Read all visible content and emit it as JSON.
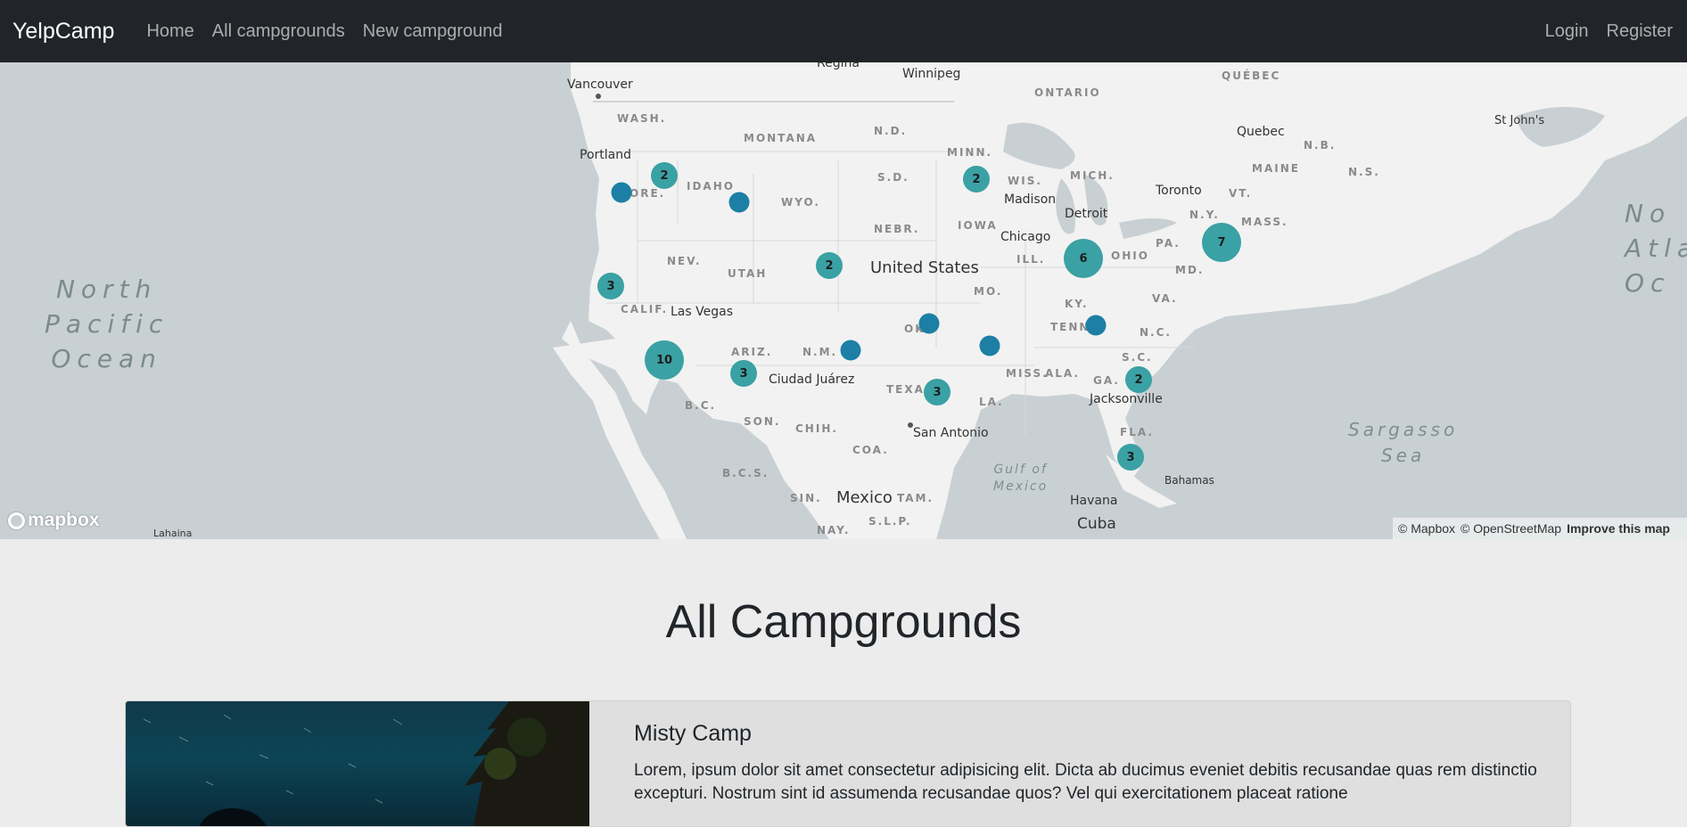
{
  "navbar": {
    "brand": "YelpCamp",
    "links": [
      "Home",
      "All campgrounds",
      "New campground"
    ],
    "right_links": [
      "Login",
      "Register"
    ]
  },
  "map": {
    "labels": {
      "vancouver": "Vancouver",
      "regina": "Regina",
      "winnipeg": "Winnipeg",
      "ontario": "ONTARIO",
      "quebec_prov": "QUÉBEC",
      "st_johns": "St John's",
      "quebec": "Quebec",
      "nb": "N.B.",
      "ns": "N.S.",
      "maine": "MAINE",
      "wash": "WASH.",
      "montana": "MONTANA",
      "nd": "N.D.",
      "minn": "MINN.",
      "portland": "Portland",
      "ore": "ORE.",
      "idaho": "IDAHO",
      "wyo": "WYO.",
      "sd": "S.D.",
      "wis": "WIS.",
      "mich": "MICH.",
      "madison": "Madison",
      "toronto": "Toronto",
      "detroit": "Detroit",
      "vt": "VT.",
      "mass": "MASS.",
      "ny": "N.Y.",
      "nebr": "NEBR.",
      "iowa": "IOWA",
      "chicago": "Chicago",
      "ill": "ILL.",
      "ohio": "OHIO",
      "pa": "PA.",
      "md": "MD.",
      "nev": "NEV.",
      "utah": "UTAH",
      "united_states": "United States",
      "mo": "MO.",
      "va": "VA.",
      "ky": "KY.",
      "calif": "CALIF.",
      "las_vegas": "Las Vegas",
      "ok": "OK",
      "tenn": "TENN.",
      "nc": "N.C.",
      "ariz": "ARIZ.",
      "nm": "N.M.",
      "ciudad_juarez": "Ciudad Juárez",
      "sc": "S.C.",
      "miss": "MISS.",
      "ala": "ALA.",
      "ga": "GA.",
      "texas": "TEXAS",
      "la": "LA.",
      "jacksonville": "Jacksonville",
      "bc": "B.C.",
      "son": "SON.",
      "chih": "CHIH.",
      "san_antonio": "San Antonio",
      "fla": "FLA.",
      "coa": "COA.",
      "bcs": "B.C.S.",
      "sin": "SIN.",
      "mexico": "Mexico",
      "tam": "TAM.",
      "havana": "Havana",
      "bahamas": "Bahamas",
      "cuba": "Cuba",
      "nay": "NAY.",
      "slp": "S.L.P.",
      "lahaina": "Lahaina",
      "north_pacific": "North\nPacific\nOcean",
      "north_atlantic": "No\nAtla\nOc",
      "sargasso": "Sargasso\nSea",
      "gulf": "Gulf of\nMexico"
    },
    "clusters": [
      "2",
      "2",
      "2",
      "3",
      "6",
      "7",
      "10",
      "3",
      "3",
      "2",
      "3"
    ],
    "logo": "mapbox",
    "attribution": [
      "© Mapbox",
      "© OpenStreetMap",
      "Improve this map"
    ]
  },
  "main": {
    "title": "All Campgrounds",
    "campgrounds": [
      {
        "title": "Misty Camp",
        "description": "Lorem, ipsum dolor sit amet consectetur adipisicing elit. Dicta ab ducimus eveniet debitis recusandae quas rem distinctio excepturi. Nostrum sint id assumenda recusandae quos? Vel qui exercitationem placeat ratione"
      }
    ]
  },
  "colors": {
    "navbar_bg": "#212529",
    "cluster": "#3aa1a4",
    "point": "#1d7fa5",
    "page_bg": "#ececec"
  }
}
